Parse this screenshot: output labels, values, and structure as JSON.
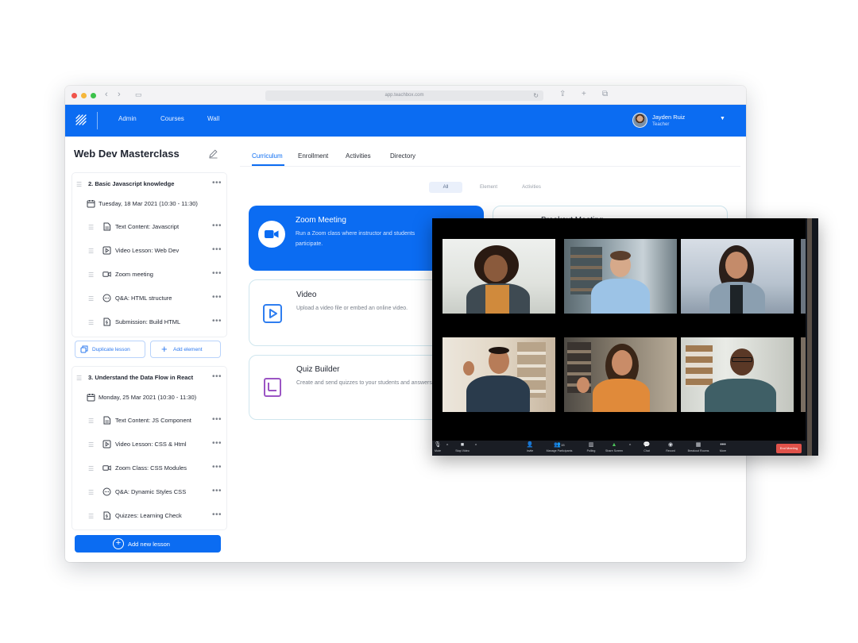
{
  "browser": {
    "url": "app.teachbox.com"
  },
  "header": {
    "nav": [
      "Admin",
      "Courses",
      "Wall"
    ],
    "user": {
      "name": "Jayden Ruiz",
      "role": "Teacher"
    }
  },
  "sidebar": {
    "course_title": "Web Dev Masterclass",
    "sections": [
      {
        "title": "2. Basic Javascript knowledge",
        "date": "Tuesday, 18 Mar 2021 (10:30 - 11:30)",
        "items": [
          {
            "icon": "document-icon",
            "label": "Text Content: Javascript"
          },
          {
            "icon": "play-icon",
            "label": "Video Lesson: Web Dev"
          },
          {
            "icon": "video-camera-icon",
            "label": "Zoom meeting"
          },
          {
            "icon": "chat-bubble-icon",
            "label": "Q&A: HTML structure"
          },
          {
            "icon": "submission-icon",
            "label": "Submission: Build HTML"
          }
        ],
        "actions": {
          "duplicate": "Duplicate lesson",
          "add_element": "Add element"
        }
      },
      {
        "title": "3. Understand the Data Flow in React",
        "date": "Monday, 25 Mar 2021 (10:30 - 11:30)",
        "items": [
          {
            "icon": "document-icon",
            "label": "Text Content: JS Component"
          },
          {
            "icon": "play-icon",
            "label": "Video Lesson: CSS & Html"
          },
          {
            "icon": "video-camera-icon",
            "label": "Zoom Class: CSS Modules"
          },
          {
            "icon": "chat-bubble-icon",
            "label": "Q&A: Dynamic Styles CSS"
          },
          {
            "icon": "submission-icon",
            "label": "Quizzes: Learning Check"
          }
        ]
      }
    ],
    "add_lesson": "Add new lesson"
  },
  "main": {
    "tabs": [
      "Curriculum",
      "Enrollment",
      "Activities",
      "Directory"
    ],
    "active_tab": "Curriculum",
    "filters": [
      "All",
      "Element",
      "Activities"
    ],
    "active_filter": "All",
    "activities": [
      {
        "title": "Zoom Meeting",
        "description": "Run a Zoom class where instructor and students participate.",
        "icon": "video-camera-icon"
      },
      {
        "title": "Video",
        "description": "Upload a video file or embed an online video.",
        "icon": "play-icon"
      },
      {
        "title": "Quiz Builder",
        "description": "Create and send quizzes to your students and answers",
        "icon": "quiz-icon"
      }
    ],
    "partial_card_title": "Breakout Meeting"
  },
  "zoom": {
    "toolbar": [
      "Mute",
      "Stop Video",
      "Invite",
      "Manage Participants",
      "Polling",
      "Share Screen",
      "Chat",
      "Record",
      "Breakout Rooms",
      "More"
    ],
    "participant_count": "15",
    "end_label": "End Meeting"
  },
  "colors": {
    "brand_blue": "#0b6cf2",
    "card_border": "#cfe6ee",
    "zoom_bg": "#0d1117",
    "end_red": "#e0524a"
  }
}
